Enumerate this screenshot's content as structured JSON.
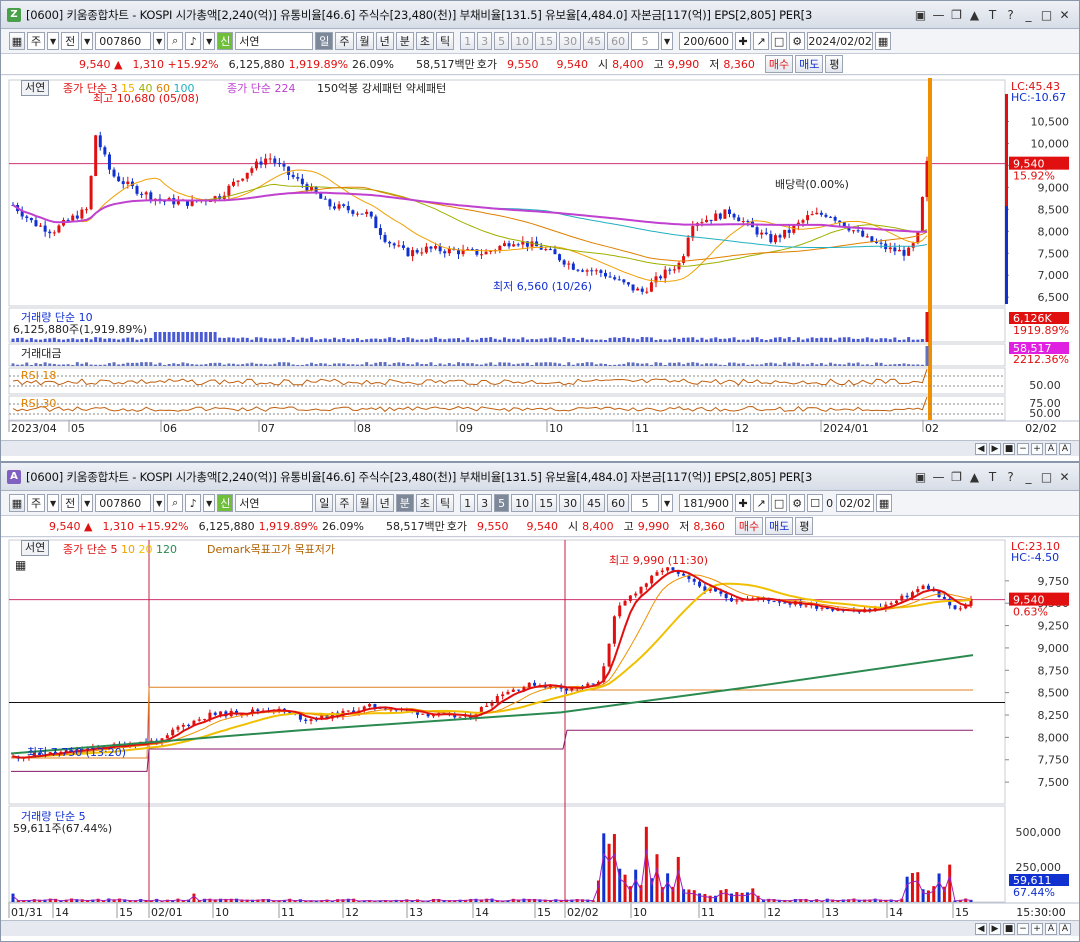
{
  "top": {
    "badge": "Z",
    "title": "[0600] 키움종합차트 - KOSPI 시가총액[2,240(억)] 유통비율[46.6] 주식수[23,480(천)] 부채비율[131.5] 유보율[4,484.0] 자본금[117(억)] EPS[2,805] PER[3",
    "toolbar": {
      "mode1": "주",
      "mode2": "전",
      "code": "007860",
      "name": "서연",
      "periods": [
        "일",
        "주",
        "월",
        "년",
        "분",
        "초",
        "틱"
      ],
      "intervals": [
        "1",
        "3",
        "5",
        "10",
        "15",
        "30",
        "45",
        "60"
      ],
      "interval_value": "5",
      "count": "200/600",
      "date": "2024/02/02"
    },
    "price": {
      "last": "9,540 ▲",
      "change": "1,310 +15.92%",
      "volume": "6,125,880",
      "vol_ratio": "1,919.89%",
      "turnover": "26.09%",
      "amount": "58,517백만",
      "quote_label": "호가",
      "ask": "9,550",
      "bid": "9,540",
      "open_label": "시",
      "open": "8,400",
      "high_label": "고",
      "high": "9,990",
      "low_label": "저",
      "low": "8,360",
      "buy": "매수",
      "sell": "매도",
      "even": "평"
    },
    "chart": {
      "button": "서연",
      "ma_legend": [
        "종가 단순",
        "3",
        "15",
        "40",
        "60",
        "100"
      ],
      "ma2_label": "종가 단순 224",
      "strength": "150억봉 강세패턴 약세패턴",
      "high_note": "최고 10,680 (05/08)",
      "low_note": "최저 6,560 (10/26)",
      "dividend": "배당락(0.00%)",
      "lc": "LC:45.43",
      "hc": "HC:-10.67",
      "price_ticks": [
        "10,500",
        "10,000",
        "9,500",
        "9,000",
        "8,500",
        "8,000",
        "7,500",
        "7,000",
        "6,500"
      ],
      "current_tag": "9,540",
      "current_pct": "15.92%",
      "volume_label": "거래량 단순 10",
      "volume_value": "6,125,880주(1,919.89%)",
      "volume_tag": "6,126K",
      "volume_pct": "1919.89%",
      "amount_label": "거래대금",
      "amount_tag": "58,517",
      "amount_pct": "2212.36%",
      "rsi18": "RSI 18",
      "rsi30": "RSI 30",
      "rsi_ticks": [
        "50.00",
        "75.00",
        "50.00"
      ],
      "dates": [
        "2023/04",
        "05",
        "06",
        "07",
        "08",
        "09",
        "10",
        "11",
        "12",
        "2024/01",
        "02"
      ],
      "date_right": "02/02"
    }
  },
  "bottom": {
    "badge": "A",
    "title": "[0600] 키움종합차트 - KOSPI 시가총액[2,240(억)] 유통비율[46.6] 주식수[23,480(천)] 부채비율[131.5] 유보율[4,484.0] 자본금[117(억)] EPS[2,805] PER[3",
    "toolbar": {
      "mode1": "주",
      "mode2": "전",
      "code": "007860",
      "name": "서연",
      "periods": [
        "일",
        "주",
        "월",
        "년",
        "분",
        "초",
        "틱"
      ],
      "intervals": [
        "1",
        "3",
        "5",
        "10",
        "15",
        "30",
        "45",
        "60"
      ],
      "interval_value": "5",
      "count": "181/900",
      "date": "02/02",
      "check_label": "0"
    },
    "price": {
      "last": "9,540 ▲",
      "change": "1,310 +15.92%",
      "volume": "6,125,880",
      "vol_ratio": "1,919.89%",
      "turnover": "26.09%",
      "amount": "58,517백만",
      "quote_label": "호가",
      "ask": "9,550",
      "bid": "9,540",
      "open_label": "시",
      "open": "8,400",
      "high_label": "고",
      "high": "9,990",
      "low_label": "저",
      "low": "8,360",
      "buy": "매수",
      "sell": "매도",
      "even": "평"
    },
    "chart": {
      "button": "서연",
      "ma_legend": [
        "종가 단순",
        "5",
        "10",
        "20",
        "120"
      ],
      "demark": "Demark목표고가 목표저가",
      "high_note": "최고 9,990 (11:30)",
      "low_note": "최저 7,750 (13:20)",
      "lc": "LC:23.10",
      "hc": "HC:-4.50",
      "price_ticks": [
        "9,750",
        "9,500",
        "9,250",
        "9,000",
        "8,750",
        "8,500",
        "8,250",
        "8,000",
        "7,750",
        "7,500"
      ],
      "current_tag": "9,540",
      "current_pct": "0.63%",
      "volume_label": "거래량 단순 5",
      "volume_value": "59,611주(67.44%)",
      "volume_ticks": [
        "500,000",
        "250,000"
      ],
      "volume_tag": "59,611",
      "volume_pct": "67.44%",
      "dates": [
        "01/31",
        "14",
        "15",
        "02/01",
        "10",
        "11",
        "12",
        "13",
        "14",
        "15",
        "02/02",
        "10",
        "11",
        "12",
        "13",
        "14",
        "15"
      ],
      "time_right": "15:30:00"
    }
  },
  "colors": {
    "up": "#e01010",
    "down": "#1030d0",
    "ma224": "#c040d0",
    "ma120": "#2a8a50",
    "yellow": "#f0b000",
    "orange": "#f09000"
  }
}
